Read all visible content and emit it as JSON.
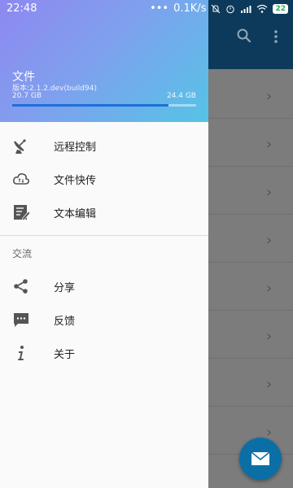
{
  "status_bar": {
    "time": "22:48",
    "dots": "•••",
    "speed": "0.1K/s",
    "battery": "22"
  },
  "drawer": {
    "title": "文件",
    "version": "版本:2.1.2.dev(build94)",
    "storage_used": "20.7 GB",
    "storage_total": "24.4 GB",
    "storage_progress_percent": 84.8,
    "menu_top": [
      {
        "label": "远程控制",
        "icon": "satellite-dish-icon"
      },
      {
        "label": "文件快传",
        "icon": "cloud-transfer-icon"
      },
      {
        "label": "文本编辑",
        "icon": "edit-document-icon"
      }
    ],
    "section_label": "交流",
    "menu_bottom": [
      {
        "label": "分享",
        "icon": "share-icon"
      },
      {
        "label": "反馈",
        "icon": "feedback-icon"
      },
      {
        "label": "关于",
        "icon": "info-icon"
      }
    ]
  },
  "colors": {
    "header_gradient_start": "#8e88f0",
    "header_gradient_end": "#55c4e6",
    "progress": "#1e6fd9",
    "fab": "#0b6fa6",
    "toolbar": "#0d3a5a"
  }
}
